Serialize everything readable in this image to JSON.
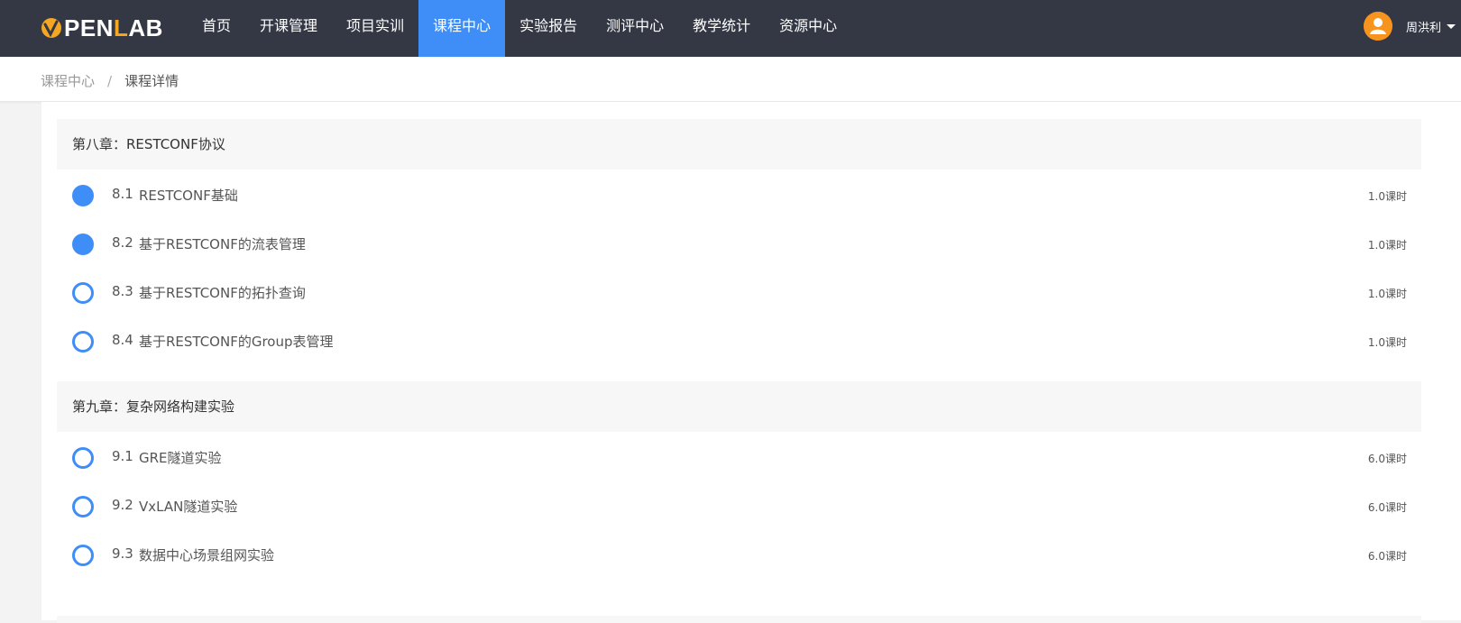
{
  "brand": {
    "logo_text_pre": "PEN",
    "logo_text_accent": "L",
    "logo_text_post": "AB",
    "accent_color": "#f5a623",
    "active_color": "#3f8ef7",
    "header_bg": "#343845"
  },
  "nav": {
    "items": [
      {
        "label": "首页"
      },
      {
        "label": "开课管理"
      },
      {
        "label": "项目实训"
      },
      {
        "label": "课程中心"
      },
      {
        "label": "实验报告"
      },
      {
        "label": "测评中心"
      },
      {
        "label": "教学统计"
      },
      {
        "label": "资源中心"
      }
    ],
    "active_index": 3
  },
  "user": {
    "name": "周洪利",
    "avatar_icon": "user-avatar-icon"
  },
  "breadcrumb": {
    "parent": "课程中心",
    "separator": "/",
    "current": "课程详情"
  },
  "chapters": [
    {
      "title": "第八章：RESTCONF协议",
      "lessons": [
        {
          "num": "8.1",
          "title": "RESTCONF基础",
          "hours": "1.0课时",
          "completed": true
        },
        {
          "num": "8.2",
          "title": "基于RESTCONF的流表管理",
          "hours": "1.0课时",
          "completed": true
        },
        {
          "num": "8.3",
          "title": "基于RESTCONF的拓扑查询",
          "hours": "1.0课时",
          "completed": false
        },
        {
          "num": "8.4",
          "title": "基于RESTCONF的Group表管理",
          "hours": "1.0课时",
          "completed": false
        }
      ]
    },
    {
      "title": "第九章：复杂网络构建实验",
      "lessons": [
        {
          "num": "9.1",
          "title": "GRE隧道实验",
          "hours": "6.0课时",
          "completed": false
        },
        {
          "num": "9.2",
          "title": "VxLAN隧道实验",
          "hours": "6.0课时",
          "completed": false
        },
        {
          "num": "9.3",
          "title": "数据中心场景组网实验",
          "hours": "6.0课时",
          "completed": false
        }
      ]
    }
  ]
}
